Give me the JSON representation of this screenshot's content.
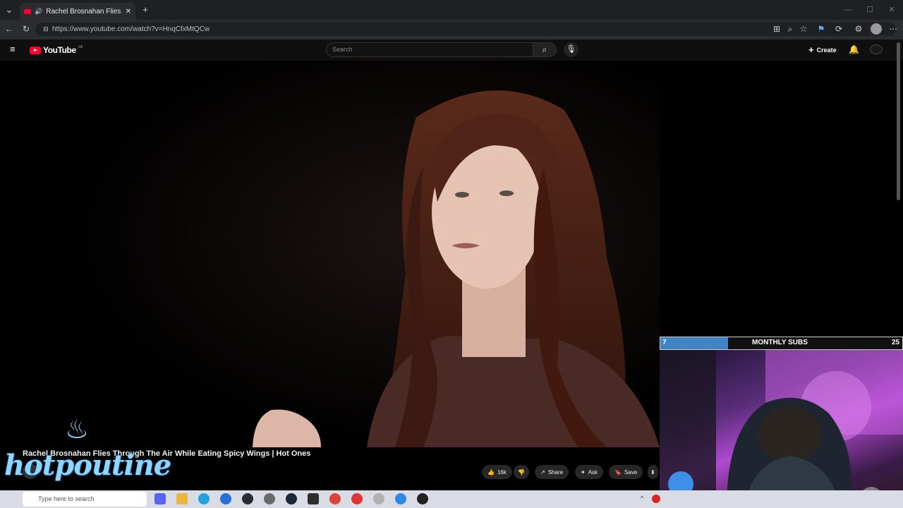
{
  "browser": {
    "tab_title": "Rachel Brosnahan Flies Throu",
    "url": "https://www.youtube.com/watch?v=HnqCfxMtQCw"
  },
  "youtube": {
    "logo_text": "YouTube",
    "region": "CA",
    "search_placeholder": "Search",
    "create_label": "Create"
  },
  "video": {
    "title": "Rachel Brosnahan Flies Through The Air While Eating Spicy Wings | Hot Ones",
    "likes": "16k",
    "share_label": "Share",
    "ask_label": "Ask",
    "save_label": "Save"
  },
  "overlay": {
    "current_subs": "7",
    "goal_label": "MONTHLY SUBS",
    "goal_target": "25",
    "progress_fraction": 0.28,
    "watermark": "hotpoutine"
  },
  "taskbar": {
    "search_placeholder": "Type here to search"
  },
  "colors": {
    "yt_red": "#ff0033",
    "subs_fill": "#3f85c6"
  }
}
